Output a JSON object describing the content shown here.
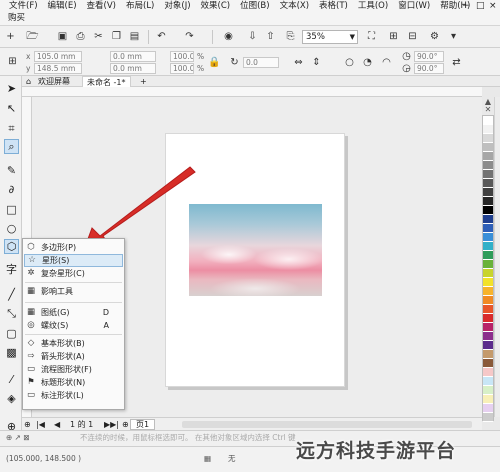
{
  "menubar": {
    "items": [
      "文件(F)",
      "编辑(E)",
      "查看(V)",
      "布局(L)",
      "对象(J)",
      "效果(C)",
      "位图(B)",
      "文本(X)",
      "表格(T)",
      "工具(O)",
      "窗口(W)",
      "帮助(H)"
    ],
    "second_row": "购买",
    "window_controls": [
      "−",
      "□",
      "×"
    ]
  },
  "toolbar": {
    "zoom": "35%"
  },
  "propbar": {
    "x_value": "105.0 mm",
    "y_value": "148.5 mm",
    "w_value": "0.0 mm",
    "h_value": "0.0 mm",
    "scale_w": "100.0",
    "scale_h": "100.0",
    "pct": "%",
    "rotation": "0.0",
    "angle1": "90.0°",
    "angle2": "90.0°"
  },
  "doctabs": {
    "welcome": "欢迎屏幕",
    "untitled": "未命名 -1*",
    "add": "+"
  },
  "flyout": {
    "items": [
      {
        "label": "多边形(P)",
        "icon": "polygon-icon",
        "glyph": "⬡"
      },
      {
        "label": "星形(S)",
        "icon": "star-icon",
        "glyph": "☆"
      },
      {
        "label": "复杂星形(C)",
        "icon": "complex-star-icon",
        "glyph": "✲"
      },
      {
        "label": "影响工具",
        "icon": "impact-tool-icon",
        "glyph": "▦"
      },
      {
        "label": "图纸(G)",
        "icon": "graph-paper-icon",
        "glyph": "▦",
        "key": "D"
      },
      {
        "label": "螺纹(S)",
        "icon": "spiral-icon",
        "glyph": "◎",
        "key": "A"
      },
      {
        "label": "基本形状(B)",
        "icon": "basic-shapes-icon",
        "glyph": "◇"
      },
      {
        "label": "箭头形状(A)",
        "icon": "arrow-shapes-icon",
        "glyph": "⇨"
      },
      {
        "label": "流程图形状(F)",
        "icon": "flowchart-shapes-icon",
        "glyph": "▭"
      },
      {
        "label": "标题形状(N)",
        "icon": "banner-shapes-icon",
        "glyph": "⚑"
      },
      {
        "label": "标注形状(L)",
        "icon": "callout-shapes-icon",
        "glyph": "▭"
      }
    ]
  },
  "pagenav": {
    "page_count": "1 的 1",
    "page_tab": "页1"
  },
  "status": {
    "coords": "(105.000, 148.500 )",
    "fill": "无",
    "hint": "不连续的时候，用鼠标框选即可。 在其他对象区域内选择 Ctrl 键"
  },
  "watermark": "远方科技手游平台",
  "palette": [
    "#ffffff",
    "#f2f2f2",
    "#d9d9d9",
    "#bfbfbf",
    "#a6a6a6",
    "#8c8c8c",
    "#737373",
    "#595959",
    "#404040",
    "#262626",
    "#000000",
    "#1f3f8f",
    "#2e5fb8",
    "#3a8fd8",
    "#30b0c8",
    "#2f9c5a",
    "#69b23a",
    "#c8d42c",
    "#f2e22a",
    "#f7b32b",
    "#f08a24",
    "#e8562a",
    "#d92b2b",
    "#b82367",
    "#8c2d8c",
    "#5c2d8c",
    "#c49a6c",
    "#8a5a3a",
    "#f6c8c8",
    "#c8e6f6",
    "#d8f0c8",
    "#f8f0b8",
    "#e6d0f0",
    "#cccccc"
  ]
}
